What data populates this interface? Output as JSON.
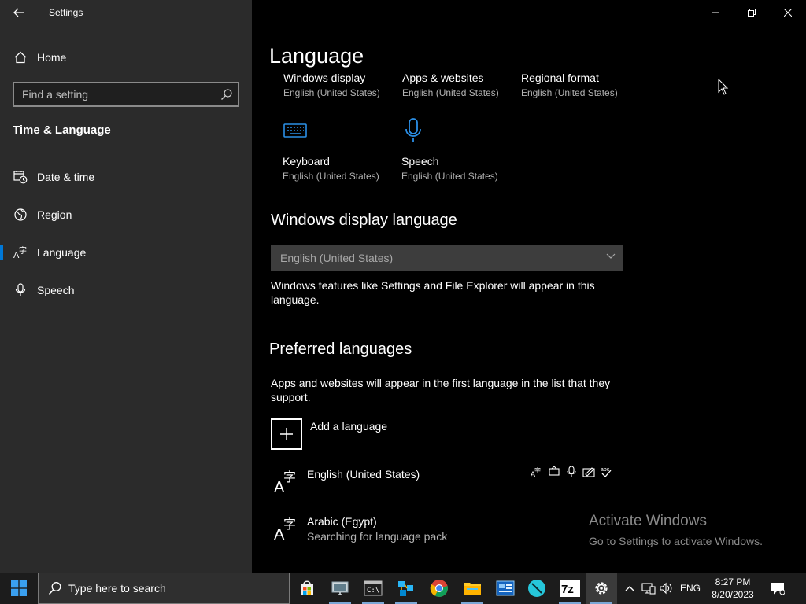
{
  "window": {
    "title": "Settings",
    "controls": [
      "minimize",
      "maximize",
      "close"
    ]
  },
  "sidebar": {
    "home_label": "Home",
    "search_placeholder": "Find a setting",
    "section_heading": "Time & Language",
    "items": [
      {
        "label": "Date & time",
        "icon": "calendar-clock-icon"
      },
      {
        "label": "Region",
        "icon": "globe-icon"
      },
      {
        "label": "Language",
        "icon": "language-icon",
        "selected": true
      },
      {
        "label": "Speech",
        "icon": "microphone-icon"
      }
    ]
  },
  "main": {
    "title": "Language",
    "tiles": [
      {
        "name": "Windows display",
        "sub": "English (United States)"
      },
      {
        "name": "Apps & websites",
        "sub": "English (United States)"
      },
      {
        "name": "Regional format",
        "sub": "English (United States)"
      },
      {
        "name": "Keyboard",
        "sub": "English (United States)",
        "icon": "keyboard-icon"
      },
      {
        "name": "Speech",
        "sub": "English (United States)",
        "icon": "microphone-icon"
      }
    ],
    "display_language": {
      "heading": "Windows display language",
      "selected": "English (United States)",
      "description": "Windows features like Settings and File Explorer will appear in this language."
    },
    "preferred": {
      "heading": "Preferred languages",
      "description": "Apps and websites will appear in the first language in the list that they support.",
      "add_label": "Add a language",
      "languages": [
        {
          "name": "English (United States)",
          "status": ""
        },
        {
          "name": "Arabic (Egypt)",
          "status": "Searching for language pack"
        }
      ]
    },
    "activation": {
      "line1": "Activate Windows",
      "line2": "Go to Settings to activate Windows."
    }
  },
  "taskbar": {
    "search_placeholder": "Type here to search",
    "apps": [
      "store-icon",
      "remote-desktop-icon",
      "command-prompt-icon",
      "network-app-icon",
      "chrome-icon",
      "file-explorer-icon",
      "control-panel-icon",
      "teal-app-icon",
      "7zip-icon",
      "settings-gear-icon"
    ],
    "input_language": "ENG",
    "time": "8:27 PM",
    "date": "8/20/2023"
  },
  "colors": {
    "sidebar_bg": "#2b2b2b",
    "main_bg": "#000000",
    "accent": "#0078d7",
    "taskbar_bg": "#1c1c1c"
  }
}
